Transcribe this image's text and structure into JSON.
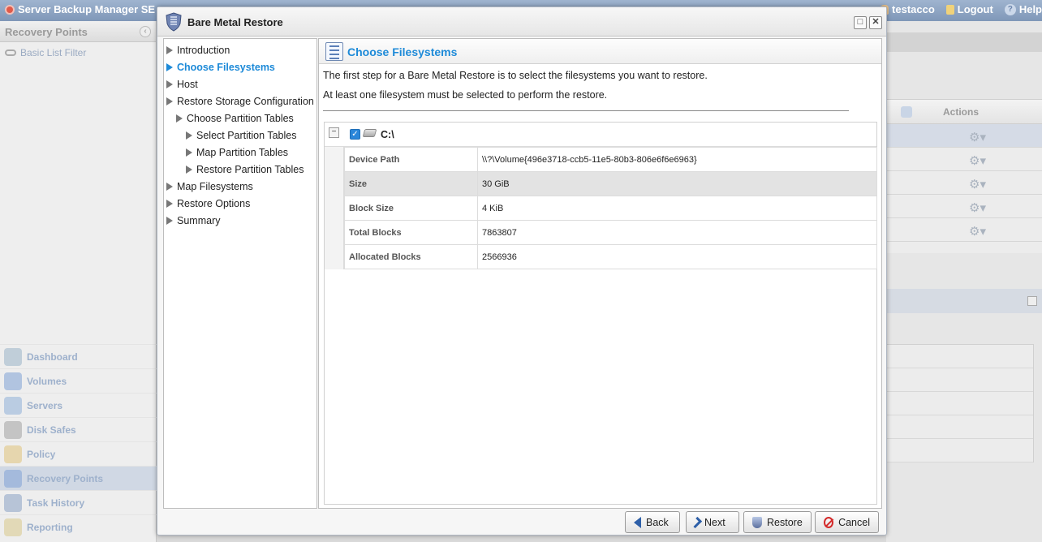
{
  "app": {
    "title": "Server Backup Manager SE",
    "user": "testacco",
    "logout": "Logout",
    "help": "Help"
  },
  "left_panel": {
    "title": "Recovery Points",
    "filter": "Basic List Filter",
    "nav": [
      {
        "label": "Dashboard",
        "icon": "dashboard-icon",
        "color": "#9bb4c9"
      },
      {
        "label": "Volumes",
        "icon": "volumes-icon",
        "color": "#7fa3d6"
      },
      {
        "label": "Servers",
        "icon": "servers-icon",
        "color": "#8fb0d8"
      },
      {
        "label": "Disk Safes",
        "icon": "disk-safes-icon",
        "color": "#a3a3a3"
      },
      {
        "label": "Policy",
        "icon": "policy-icon",
        "color": "#e0c37a"
      },
      {
        "label": "Recovery Points",
        "icon": "recovery-points-icon",
        "color": "#7fa3d6"
      },
      {
        "label": "Task History",
        "icon": "task-history-icon",
        "color": "#8aa2c4"
      },
      {
        "label": "Reporting",
        "icon": "reporting-icon",
        "color": "#d8c98a"
      }
    ],
    "active_nav": "Recovery Points"
  },
  "background_table": {
    "actions_header": "Actions"
  },
  "dialog": {
    "title": "Bare Metal Restore",
    "steps": [
      {
        "label": "Introduction",
        "level": 0,
        "current": false
      },
      {
        "label": "Choose Filesystems",
        "level": 0,
        "current": true
      },
      {
        "label": "Host",
        "level": 0,
        "current": false
      },
      {
        "label": "Restore Storage Configuration",
        "level": 0,
        "current": false
      },
      {
        "label": "Choose Partition Tables",
        "level": 1,
        "current": false
      },
      {
        "label": "Select Partition Tables",
        "level": 2,
        "current": false
      },
      {
        "label": "Map Partition Tables",
        "level": 2,
        "current": false
      },
      {
        "label": "Restore Partition Tables",
        "level": 2,
        "current": false
      },
      {
        "label": "Map Filesystems",
        "level": 0,
        "current": false
      },
      {
        "label": "Restore Options",
        "level": 0,
        "current": false
      },
      {
        "label": "Summary",
        "level": 0,
        "current": false
      }
    ],
    "content": {
      "heading": "Choose Filesystems",
      "intro": "The first step for a Bare Metal Restore is to select the filesystems you want to restore.",
      "note": "At least one filesystem must be selected to perform the restore.",
      "filesystem": {
        "name": "C:\\",
        "checked": true,
        "details": [
          {
            "key": "Device Path",
            "value": "\\\\?\\Volume{496e3718-ccb5-11e5-80b3-806e6f6e6963}"
          },
          {
            "key": "Size",
            "value": "30 GiB"
          },
          {
            "key": "Block Size",
            "value": "4 KiB"
          },
          {
            "key": "Total Blocks",
            "value": "7863807"
          },
          {
            "key": "Allocated Blocks",
            "value": "2566936"
          }
        ]
      }
    },
    "buttons": {
      "back": "Back",
      "next": "Next",
      "restore": "Restore",
      "cancel": "Cancel"
    }
  },
  "colors": {
    "accent": "#1d8ad8",
    "checkbox": "#2a86d9",
    "cancel_red": "#d42a2a"
  }
}
